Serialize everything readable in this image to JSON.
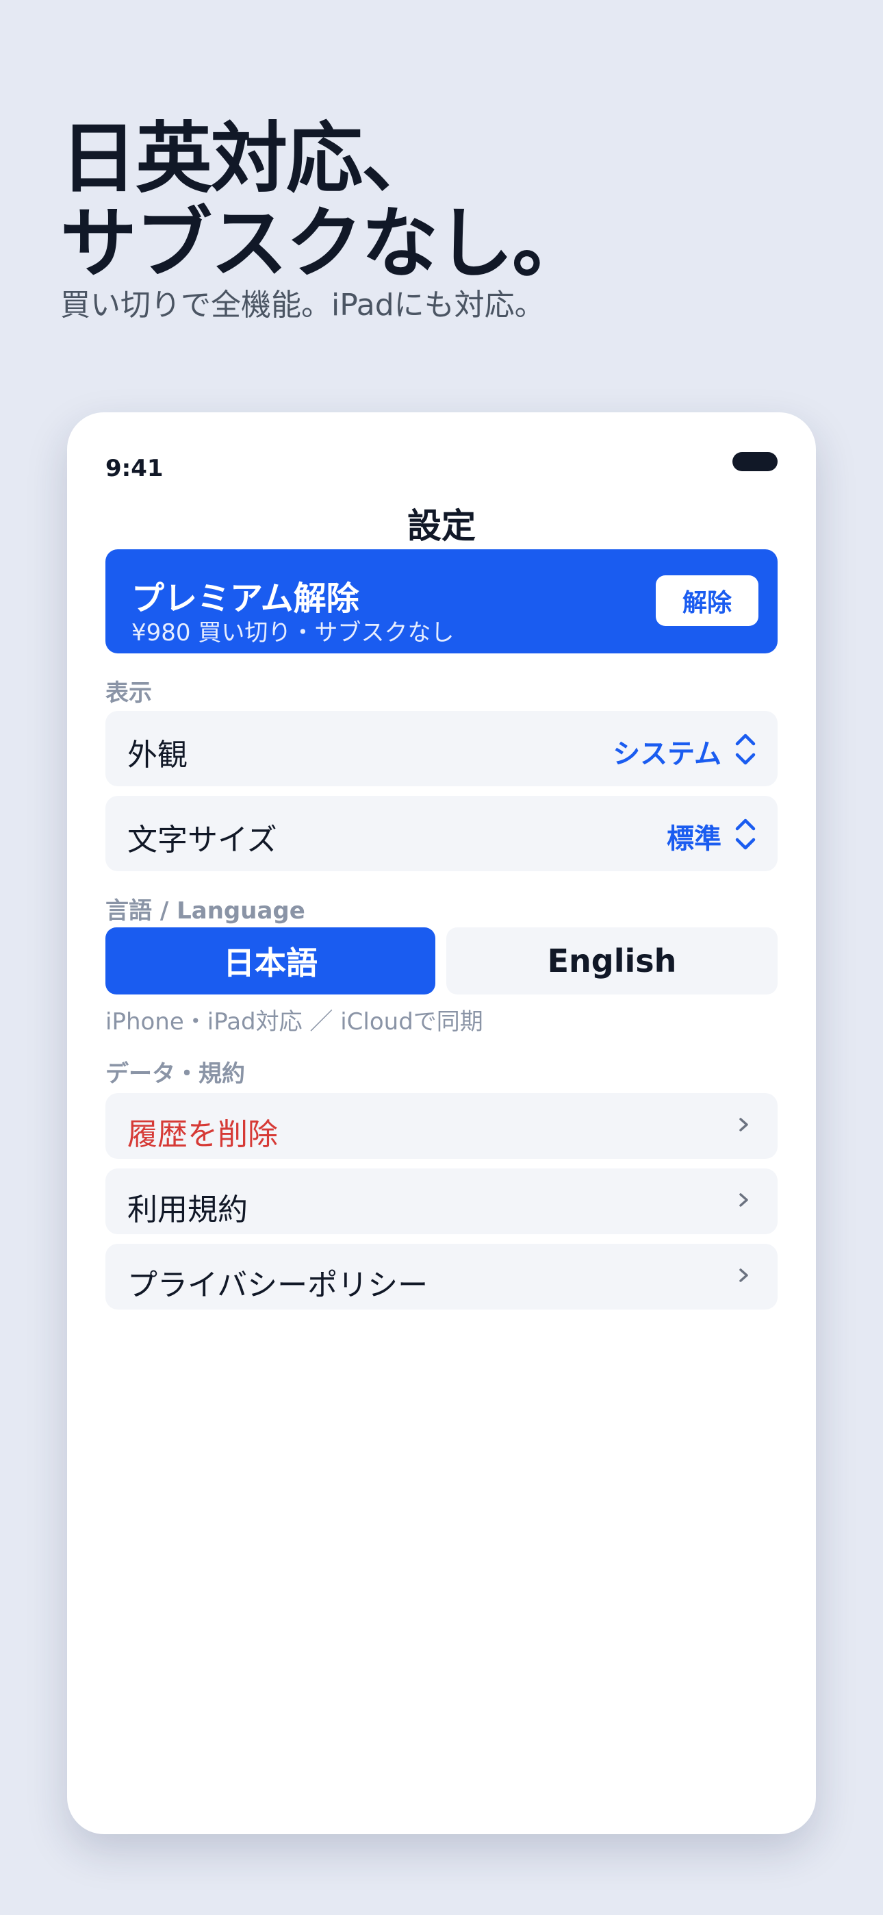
{
  "hero": {
    "headline_line1": "日英対応、",
    "headline_line2": "サブスクなし。",
    "subline": "買い切りで全機能。iPadにも対応。"
  },
  "status_bar": {
    "time": "9:41"
  },
  "nav": {
    "title": "設定"
  },
  "premium": {
    "title": "プレミアム解除",
    "subtitle": "¥980 買い切り・サブスクなし",
    "button_label": "解除"
  },
  "display_section": {
    "label": "表示",
    "appearance": {
      "label": "外観",
      "value": "システム"
    },
    "text_size": {
      "label": "文字サイズ",
      "value": "標準"
    }
  },
  "language_section": {
    "label": "言語 / Language",
    "options": [
      "日本語",
      "English"
    ],
    "selected": "日本語",
    "note": "iPhone・iPad対応 ／ iCloudで同期"
  },
  "data_section": {
    "label": "データ・規約",
    "items": [
      {
        "label": "履歴を削除",
        "style": "destructive"
      },
      {
        "label": "利用規約"
      },
      {
        "label": "プライバシーポリシー"
      }
    ]
  },
  "colors": {
    "accent": "#1a5cf0",
    "destructive": "#d63a36",
    "background": "#e5e9f3",
    "row_background": "#f3f5f9"
  }
}
